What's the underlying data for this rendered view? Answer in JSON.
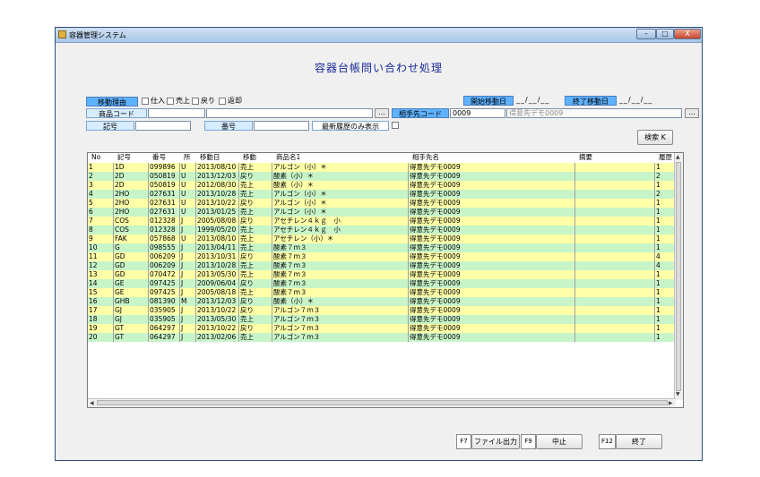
{
  "window": {
    "title": "容器管理システム",
    "min": "–",
    "max": "□",
    "close": "X"
  },
  "page_title": "容器台帳問い合わせ処理",
  "filters": {
    "move_reason_label": "移動理由",
    "checkboxes": [
      "仕入",
      "売上",
      "戻り",
      "返却"
    ],
    "start_date_label": "開始移動日",
    "start_date_value": "__/__/__",
    "end_date_label": "終了移動日",
    "end_date_value": "__/__/__",
    "product_code_label": "商品コード",
    "partner_code_label": "相手先コード",
    "partner_code_value": "0009",
    "partner_name_value": "得意先デモ0009",
    "symbol_label": "記号",
    "number_label": "番号",
    "latest_only_label": "最新履歴のみ表示",
    "dots": "...",
    "search_label": "検索 K"
  },
  "table": {
    "columns": [
      "No",
      "記号",
      "番号",
      "所",
      "移動日",
      "移動",
      "商品名1",
      "相手先名",
      "摘要",
      "履歴"
    ],
    "rows": [
      [
        "1",
        "1D",
        "099896",
        "U",
        "2013/08/10",
        "売上",
        "アルゴン（小）＊",
        "得意先デモ0009",
        "",
        "1"
      ],
      [
        "2",
        "2D",
        "050819",
        "U",
        "2013/12/03",
        "戻り",
        "酸素（小）＊",
        "得意先デモ0009",
        "",
        "2"
      ],
      [
        "3",
        "2D",
        "050819",
        "U",
        "2012/08/30",
        "売上",
        "酸素（小）＊",
        "得意先デモ0009",
        "",
        "1"
      ],
      [
        "4",
        "2HO",
        "027631",
        "U",
        "2013/10/28",
        "売上",
        "アルゴン（小）＊",
        "得意先デモ0009",
        "",
        "2"
      ],
      [
        "5",
        "2HO",
        "027631",
        "U",
        "2013/10/22",
        "戻り",
        "アルゴン（小）＊",
        "得意先デモ0009",
        "",
        "1"
      ],
      [
        "6",
        "2HO",
        "027631",
        "U",
        "2013/01/25",
        "売上",
        "アルゴン（小）＊",
        "得意先デモ0009",
        "",
        "1"
      ],
      [
        "7",
        "COS",
        "012328",
        "J",
        "2005/08/08",
        "戻り",
        "アセチレン４ｋｇ　小",
        "得意先デモ0009",
        "",
        "1"
      ],
      [
        "8",
        "COS",
        "012328",
        "J",
        "1999/05/20",
        "売上",
        "アセチレン４ｋｇ　小",
        "得意先デモ0009",
        "",
        "1"
      ],
      [
        "9",
        "FAK",
        "057868",
        "U",
        "2013/08/10",
        "売上",
        "アセチレン（小）＊",
        "得意先デモ0009",
        "",
        "1"
      ],
      [
        "10",
        "G",
        "098555",
        "J",
        "2013/04/11",
        "売上",
        "酸素７ｍ３",
        "得意先デモ0009",
        "",
        "1"
      ],
      [
        "11",
        "GD",
        "006209",
        "J",
        "2013/10/31",
        "戻り",
        "酸素７ｍ３",
        "得意先デモ0009",
        "",
        "4"
      ],
      [
        "12",
        "GD",
        "006209",
        "J",
        "2013/10/28",
        "売上",
        "酸素７ｍ３",
        "得意先デモ0009",
        "",
        "4"
      ],
      [
        "13",
        "GD",
        "070472",
        "J",
        "2013/05/30",
        "売上",
        "酸素７ｍ３",
        "得意先デモ0009",
        "",
        "1"
      ],
      [
        "14",
        "GE",
        "097425",
        "J",
        "2009/06/04",
        "戻り",
        "酸素７ｍ３",
        "得意先デモ0009",
        "",
        "1"
      ],
      [
        "15",
        "GE",
        "097425",
        "J",
        "2005/08/18",
        "売上",
        "酸素７ｍ３",
        "得意先デモ0009",
        "",
        "1"
      ],
      [
        "16",
        "GHB",
        "081390",
        "M",
        "2013/12/03",
        "戻り",
        "酸素（小）＊",
        "得意先デモ0009",
        "",
        "1"
      ],
      [
        "17",
        "GJ",
        "035905",
        "J",
        "2013/10/22",
        "戻り",
        "アルゴン７ｍ３",
        "得意先デモ0009",
        "",
        "1"
      ],
      [
        "18",
        "GJ",
        "035905",
        "J",
        "2013/05/30",
        "売上",
        "アルゴン７ｍ３",
        "得意先デモ0009",
        "",
        "1"
      ],
      [
        "19",
        "GT",
        "064297",
        "J",
        "2013/10/22",
        "戻り",
        "アルゴン７ｍ３",
        "得意先デモ0009",
        "",
        "1"
      ],
      [
        "20",
        "GT",
        "064297",
        "J",
        "2013/02/06",
        "売上",
        "アルゴン７ｍ３",
        "得意先デモ0009",
        "",
        "1"
      ]
    ]
  },
  "footer": {
    "f7": "F7",
    "export_label": "ファイル出力",
    "f9": "F9",
    "cancel_label": "中止",
    "f12": "F12",
    "exit_label": "終了"
  }
}
